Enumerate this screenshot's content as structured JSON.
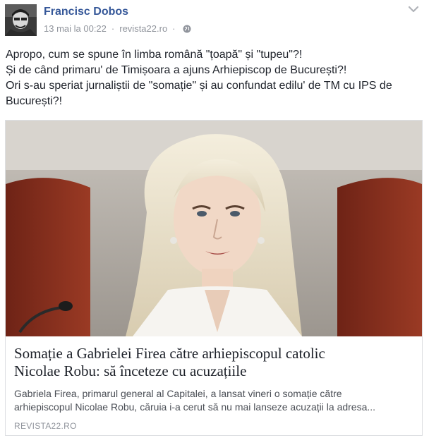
{
  "post": {
    "author": "Francisc Dobos",
    "timestamp": "13 mai la 00:22",
    "separator": "·",
    "source": "revista22.ro",
    "separator2": "·",
    "privacy_icon": "globe-icon",
    "menu_icon": "chevron-down-icon",
    "text_lines": [
      "Apropo, cum se spune în limba română \"țoapă\" și \"tupeu\"?!",
      "Și de când primaru' de Timișoara a ajuns Arhiepiscop de București?!",
      "Ori s-au speriat jurnaliștii de \"somație\" și au confundat edilu' de TM cu IPS de",
      "București?!"
    ]
  },
  "link_card": {
    "title_lines": [
      "Somație a Gabrielei Firea către arhiepiscopul catolic",
      "Nicolae Robu: să înceteze cu acuzațiile"
    ],
    "description_lines": [
      "Gabriela Firea, primarul general al Capitalei, a lansat vineri o somație către",
      "arhiepiscopul Nicolae Robu, căruia i-a cerut să nu mai lanseze acuzații la adresa..."
    ],
    "domain": "REVISTA22.RO"
  },
  "colors": {
    "author_link": "#365899",
    "meta_gray": "#90949c",
    "text": "#1d2129",
    "card_border": "#dddfe2"
  }
}
